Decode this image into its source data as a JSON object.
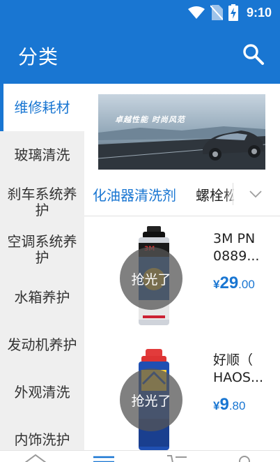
{
  "status_bar": {
    "time": "9:10",
    "icons": [
      "wifi-icon",
      "no-sim-icon",
      "battery-charging-icon"
    ]
  },
  "app_bar": {
    "title": "分类",
    "search_icon": "search-icon"
  },
  "sidebar": {
    "items": [
      {
        "label": "维修耗材",
        "active": true
      },
      {
        "label": "玻璃清洗",
        "active": false
      },
      {
        "label": "刹车系统养护",
        "active": false
      },
      {
        "label": "空调系统养护",
        "active": false
      },
      {
        "label": "水箱养护",
        "active": false
      },
      {
        "label": "发动机养护",
        "active": false
      },
      {
        "label": "外观清洗",
        "active": false
      },
      {
        "label": "内饰洗护",
        "active": false
      }
    ]
  },
  "banner": {
    "headline": "卓越性能 时尚风范"
  },
  "subcategory_tabs": {
    "items": [
      {
        "label": "化油器清洗剂",
        "active": true
      },
      {
        "label": "螺栓松动剂",
        "active": false
      }
    ],
    "expand_icon": "chevron-down-icon"
  },
  "products": [
    {
      "name_line1": "3M PN",
      "name_line2": "0889...",
      "badge": "抢光了",
      "price_currency": "¥",
      "price_int": "29",
      "price_dec": ".00",
      "can_label": "3M",
      "can_color": "#cfd3da"
    },
    {
      "name_line1": "好顺（",
      "name_line2": "HAOS...",
      "badge": "抢光了",
      "price_currency": "¥",
      "price_int": "9",
      "price_dec": ".80",
      "can_label": "",
      "can_color": "#1f4fb2"
    }
  ],
  "colors": {
    "primary": "#1976d2",
    "sidebar_bg": "#efefef",
    "badge_bg": "#555555"
  },
  "bottom_nav_icons": [
    "home-icon",
    "category-icon",
    "cart-icon",
    "profile-icon"
  ]
}
